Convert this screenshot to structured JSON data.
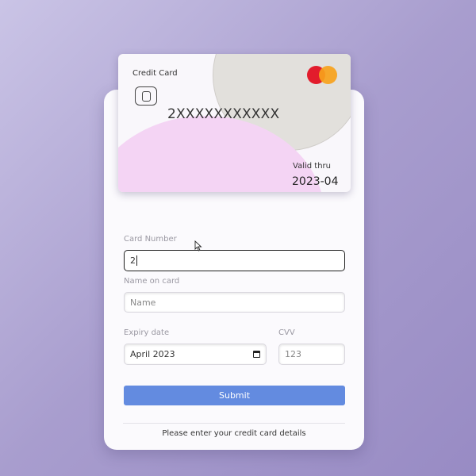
{
  "card": {
    "title": "Credit Card",
    "number": "2XXXXXXXXXXX",
    "valid_label": "Valid thru",
    "valid_value": "2023-04",
    "brand_icon": "mastercard-logo",
    "colors": {
      "brand_red": "#e21c2c",
      "brand_orange": "#f7a21b",
      "accent_pink": "#f4d4f4",
      "accent_grey": "#e2e0dc"
    }
  },
  "form": {
    "card_number": {
      "label": "Card Number",
      "value": "2"
    },
    "name_on_card": {
      "label": "Name on card",
      "placeholder": "Name"
    },
    "expiry": {
      "label": "Expiry date",
      "value": "April 2023"
    },
    "cvv": {
      "label": "CVV",
      "placeholder": "123"
    },
    "submit_label": "Submit",
    "helper_text": "Please enter your credit card details"
  },
  "colors": {
    "submit_button": "#638be0",
    "background": "#a89dce"
  }
}
